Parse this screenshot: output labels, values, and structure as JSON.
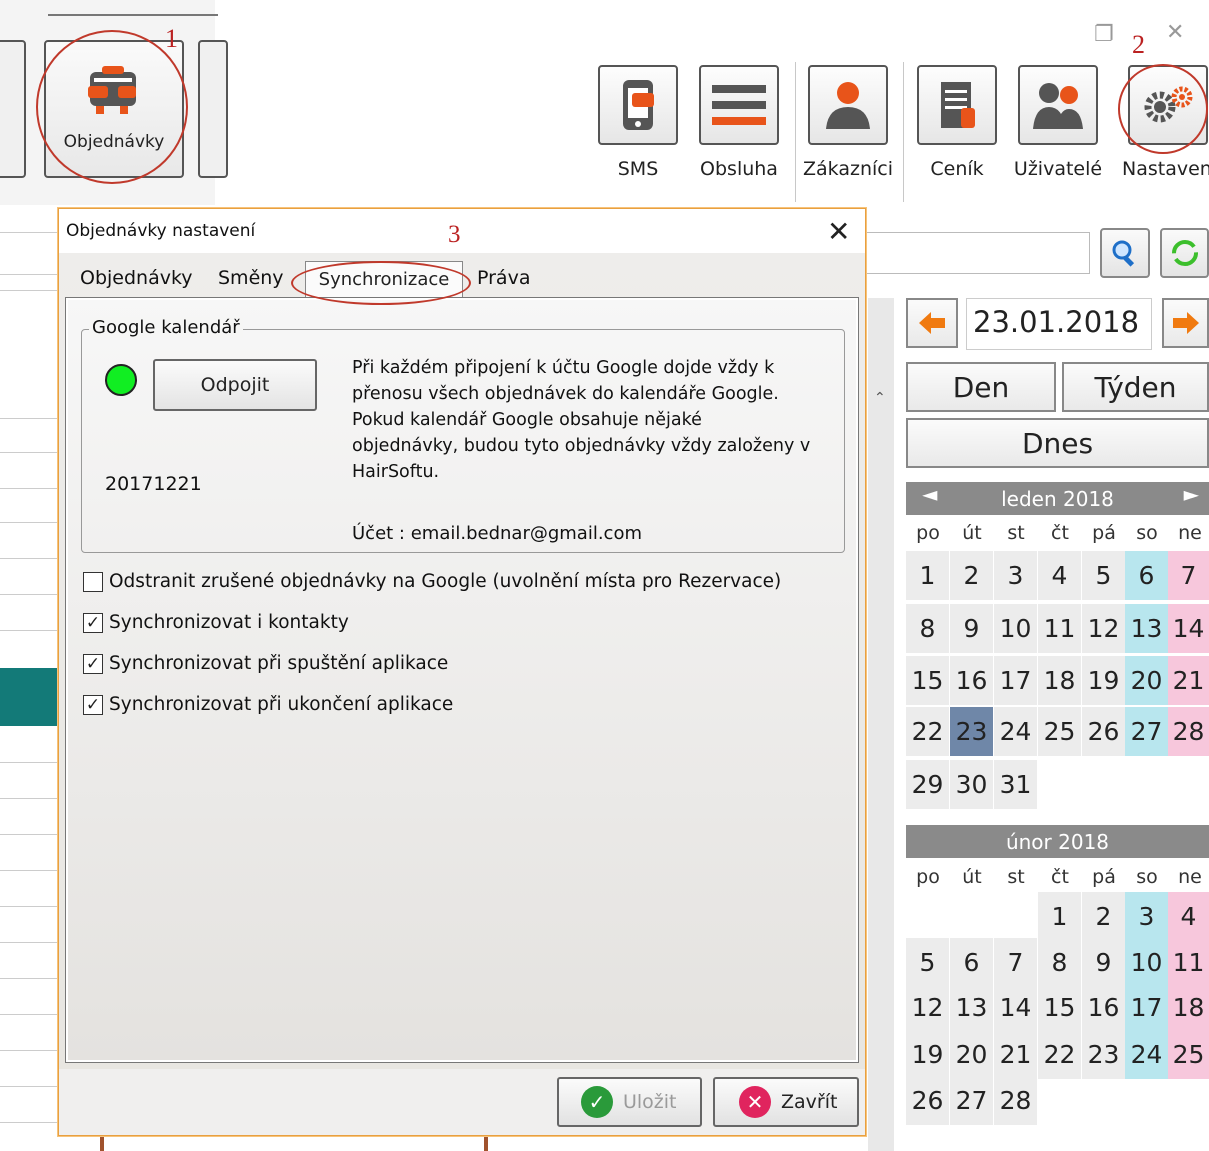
{
  "toolbar": {
    "orders_label": "Objednávky",
    "buttons": [
      {
        "label": "SMS",
        "icon": "sms-phone-icon"
      },
      {
        "label": "Obsluha",
        "icon": "menu-lines-icon"
      },
      {
        "label": "Zákazníci",
        "icon": "customer-icon"
      },
      {
        "label": "Ceník",
        "icon": "price-list-icon"
      },
      {
        "label": "Uživatelé",
        "icon": "users-icon"
      },
      {
        "label": "Nastavení",
        "icon": "gears-icon"
      }
    ]
  },
  "annotations": {
    "m1": "1",
    "m2": "2",
    "m3": "3"
  },
  "dialog": {
    "title": "Objednávky nastavení",
    "tabs": [
      "Objednávky",
      "Směny",
      "Synchronizace",
      "Práva"
    ],
    "active_tab": "Synchronizace",
    "group_title": "Google kalendář",
    "status_color": "#11ee22",
    "disconnect_label": "Odpojit",
    "sync_date": "20171221",
    "info_lines": [
      "Při každém připojení k účtu Google dojde vždy k",
      "přenosu všech objednávek do kalendáře Google.",
      "Pokud kalendář Google obsahuje nějaké",
      "objednávky, budou tyto objednávky vždy založeny v",
      "HairSoftu."
    ],
    "account": "Účet : email.bednar@gmail.com",
    "checkboxes": [
      {
        "label": "Odstranit zrušené objednávky na Google (uvolnění místa pro Rezervace)",
        "checked": false
      },
      {
        "label": "Synchronizovat i kontakty",
        "checked": true
      },
      {
        "label": "Synchronizovat při spuštění aplikace",
        "checked": true
      },
      {
        "label": "Synchronizovat při ukončení aplikace",
        "checked": true
      }
    ],
    "save_label": "Uložit",
    "close_label": "Zavřít"
  },
  "calendar": {
    "date_value": "23.01.2018",
    "day_label": "Den",
    "week_label": "Týden",
    "today_label": "Dnes",
    "weekdays": [
      "po",
      "út",
      "st",
      "čt",
      "pá",
      "so",
      "ne"
    ],
    "months": [
      {
        "title": "leden 2018",
        "first_weekday": 0,
        "days": 31,
        "selected": 23
      },
      {
        "title": "únor 2018",
        "first_weekday": 3,
        "days": 28,
        "selected": null
      }
    ],
    "colors": {
      "saturday": "#b8e6ee",
      "sunday": "#f7c7dc",
      "selected": "#6f87a8"
    }
  }
}
